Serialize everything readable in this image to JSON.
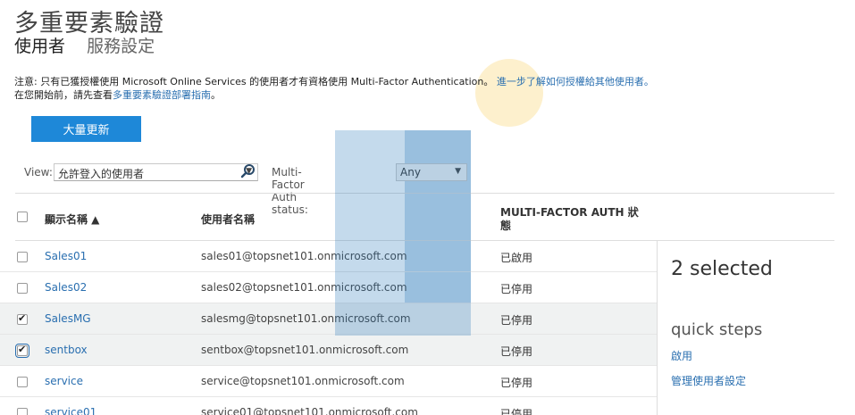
{
  "page": {
    "title": "多重要素驗證",
    "tabs": [
      {
        "label": "使用者",
        "active": true
      },
      {
        "label": "服務設定",
        "active": false
      }
    ]
  },
  "notice": {
    "line1_text": "注意: 只有已獲授權使用 Microsoft Online Services 的使用者才有資格使用 Multi-Factor Authentication。",
    "line1_link": "進一步了解如何授權給其他使用者。",
    "line2_text": "在您開始前，請先查看",
    "line2_link": "多重要素驗證部署指南",
    "line2_end": "。"
  },
  "toolbar": {
    "bulk_update_label": "大量更新"
  },
  "filters": {
    "view_label": "View:",
    "view_value": "允許登入的使用者",
    "mfa_label": "Multi-Factor Auth status:",
    "mfa_value": "Any"
  },
  "table": {
    "columns": {
      "display_name": "顯示名稱 ▲",
      "username": "使用者名稱",
      "mfa_status_line1": "MULTI-FACTOR AUTH 狀",
      "mfa_status_line2": "態"
    },
    "rows": [
      {
        "name": "Sales01",
        "user": "sales01@topsnet101.onmicrosoft.com",
        "status": "已啟用",
        "checked": false
      },
      {
        "name": "Sales02",
        "user": "sales02@topsnet101.onmicrosoft.com",
        "status": "已停用",
        "checked": false
      },
      {
        "name": "SalesMG",
        "user": "salesmg@topsnet101.onmicrosoft.com",
        "status": "已停用",
        "checked": true
      },
      {
        "name": "sentbox",
        "user": "sentbox@topsnet101.onmicrosoft.com",
        "status": "已停用",
        "checked": true
      },
      {
        "name": "service",
        "user": "service@topsnet101.onmicrosoft.com",
        "status": "已停用",
        "checked": false
      },
      {
        "name": "service01",
        "user": "service01@topsnet101.onmicrosoft.com",
        "status": "已停用",
        "checked": false
      }
    ]
  },
  "side_panel": {
    "selected_count": "2 selected",
    "quick_steps": "quick steps",
    "enable_link": "啟用",
    "manage_link": "管理使用者設定"
  },
  "colors": {
    "accent": "#1e88d8",
    "link": "#2a6fb0",
    "selected_row": "#f0f2f2"
  }
}
